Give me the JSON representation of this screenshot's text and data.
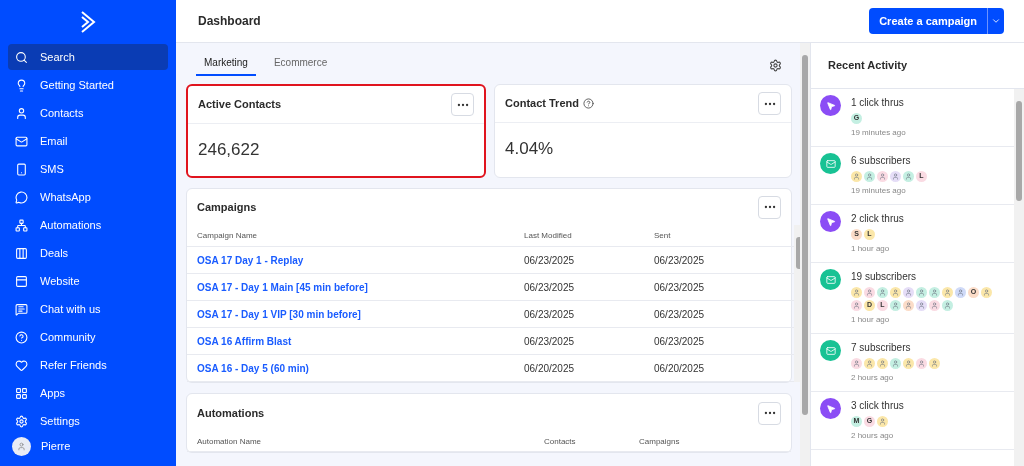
{
  "sidebar": {
    "items": [
      {
        "label": "Search",
        "selected": true
      },
      {
        "label": "Getting Started",
        "selected": false
      },
      {
        "label": "Contacts",
        "selected": false
      },
      {
        "label": "Email",
        "selected": false
      },
      {
        "label": "SMS",
        "selected": false
      },
      {
        "label": "WhatsApp",
        "selected": false
      },
      {
        "label": "Automations",
        "selected": false
      },
      {
        "label": "Deals",
        "selected": false
      },
      {
        "label": "Website",
        "selected": false
      },
      {
        "label": "Chat with us",
        "selected": false
      },
      {
        "label": "Community",
        "selected": false
      },
      {
        "label": "Refer Friends",
        "selected": false
      },
      {
        "label": "Apps",
        "selected": false
      },
      {
        "label": "Settings",
        "selected": false
      }
    ],
    "user": {
      "name": "Pierre"
    }
  },
  "header": {
    "title": "Dashboard",
    "primary_button": "Create a campaign"
  },
  "tabs": [
    {
      "label": "Marketing",
      "selected": true
    },
    {
      "label": "Ecommerce",
      "selected": false
    }
  ],
  "stat_cards": [
    {
      "title": "Active Contacts",
      "value": "246,622",
      "highlighted": true,
      "help": false
    },
    {
      "title": "Contact Trend",
      "value": "4.04%",
      "highlighted": false,
      "help": true
    }
  ],
  "campaigns": {
    "title": "Campaigns",
    "columns": [
      "Campaign Name",
      "Last Modified",
      "Sent"
    ],
    "rows": [
      [
        "OSA 17 Day 1 - Replay",
        "06/23/2025",
        "06/23/2025"
      ],
      [
        "OSA 17 - Day 1 Main [45 min before]",
        "06/23/2025",
        "06/23/2025"
      ],
      [
        "OSA 17 - Day 1 VIP [30 min before]",
        "06/23/2025",
        "06/23/2025"
      ],
      [
        "OSA 16 Affirm Blast",
        "06/23/2025",
        "06/23/2025"
      ],
      [
        "OSA 16 - Day 5 (60 min)",
        "06/20/2025",
        "06/20/2025"
      ]
    ]
  },
  "automations": {
    "title": "Automations",
    "columns": [
      "Automation Name",
      "Contacts",
      "Campaigns"
    ]
  },
  "recent_activity": {
    "title": "Recent Activity",
    "items": [
      {
        "kind": "click",
        "text": "1 click thrus",
        "time": "19 minutes ago",
        "avatars": [
          {
            "letter": "G",
            "color": "#c4efe2"
          }
        ]
      },
      {
        "kind": "subscribe",
        "text": "6 subscribers",
        "time": "19 minutes ago",
        "avatars": [
          {
            "color": "#fbe7a9"
          },
          {
            "color": "#c4efe2"
          },
          {
            "color": "#fadbe3"
          },
          {
            "color": "#e5ddf7"
          },
          {
            "color": "#c4efe2"
          },
          {
            "letter": "L",
            "color": "#fadbe3"
          }
        ]
      },
      {
        "kind": "click",
        "text": "2 click thrus",
        "time": "1 hour ago",
        "avatars": [
          {
            "letter": "S",
            "color": "#fbdcc8"
          },
          {
            "letter": "L",
            "color": "#fbe7a9"
          }
        ]
      },
      {
        "kind": "subscribe",
        "text": "19 subscribers",
        "time": "1 hour ago",
        "avatars": [
          {
            "color": "#fbe7a9"
          },
          {
            "color": "#fadbe3"
          },
          {
            "color": "#c4efe2"
          },
          {
            "color": "#fbe7a9"
          },
          {
            "color": "#e5ddf7"
          },
          {
            "color": "#c4efe2"
          },
          {
            "color": "#c4efe2"
          },
          {
            "color": "#fbe7a9"
          },
          {
            "color": "#cfdaf8"
          },
          {
            "letter": "O",
            "color": "#fbdcc8"
          },
          {
            "color": "#fbe7a9"
          },
          {
            "color": "#fadbe3"
          },
          {
            "letter": "D",
            "color": "#fbe7a9"
          },
          {
            "letter": "L",
            "color": "#fadbe3"
          },
          {
            "color": "#c4efe2"
          },
          {
            "color": "#fbdcc8"
          },
          {
            "color": "#e5ddf7"
          },
          {
            "color": "#fadbe3"
          },
          {
            "color": "#c4efe2"
          }
        ]
      },
      {
        "kind": "subscribe",
        "text": "7 subscribers",
        "time": "2 hours ago",
        "avatars": [
          {
            "color": "#fadbe3"
          },
          {
            "color": "#fbe7a9"
          },
          {
            "color": "#fbe7a9"
          },
          {
            "color": "#c4efe2"
          },
          {
            "color": "#fbe7a9"
          },
          {
            "color": "#fadbe3"
          },
          {
            "color": "#fbe7a9"
          }
        ]
      },
      {
        "kind": "click",
        "text": "3 click thrus",
        "time": "2 hours ago",
        "avatars": [
          {
            "letter": "M",
            "color": "#c4efe2"
          },
          {
            "letter": "G",
            "color": "#fadbe3"
          },
          {
            "color": "#fbe7a9"
          }
        ]
      }
    ]
  }
}
